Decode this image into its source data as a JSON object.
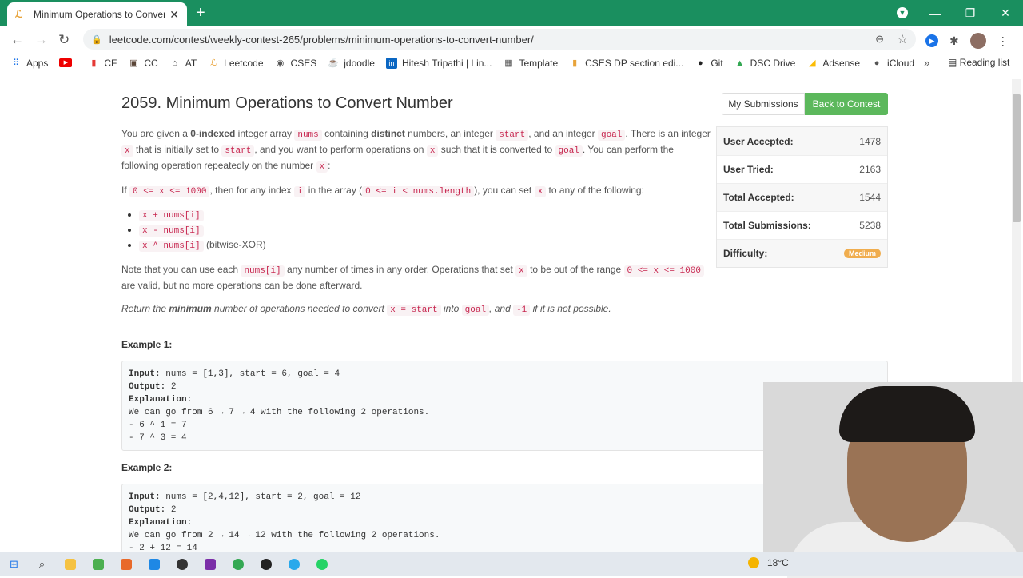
{
  "browser": {
    "tab_title": "Minimum Operations to Convert",
    "url": "leetcode.com/contest/weekly-contest-265/problems/minimum-operations-to-convert-number/",
    "bookmarks": [
      "Apps",
      "CF",
      "CC",
      "AT",
      "Leetcode",
      "CSES",
      "jdoodle",
      "Hitesh Tripathi | Lin...",
      "Template",
      "CSES DP section edi...",
      "Git",
      "DSC Drive",
      "Adsense",
      "iCloud"
    ],
    "reading_list": "Reading list"
  },
  "problem": {
    "title": "2059. Minimum Operations to Convert Number",
    "buttons": {
      "submissions": "My Submissions",
      "back": "Back to Contest"
    },
    "stats": [
      {
        "label": "User Accepted:",
        "value": "1478"
      },
      {
        "label": "User Tried:",
        "value": "2163"
      },
      {
        "label": "Total Accepted:",
        "value": "1544"
      },
      {
        "label": "Total Submissions:",
        "value": "5238"
      }
    ],
    "difficulty_label": "Difficulty:",
    "difficulty": "Medium",
    "example1_title": "Example 1:",
    "example2_title": "Example 2:"
  },
  "taskbar": {
    "weather": "18°C"
  },
  "colors": {
    "chrome": "#1a8f5f",
    "accept_button": "#5cb85c",
    "medium_badge": "#f0ad4e"
  }
}
